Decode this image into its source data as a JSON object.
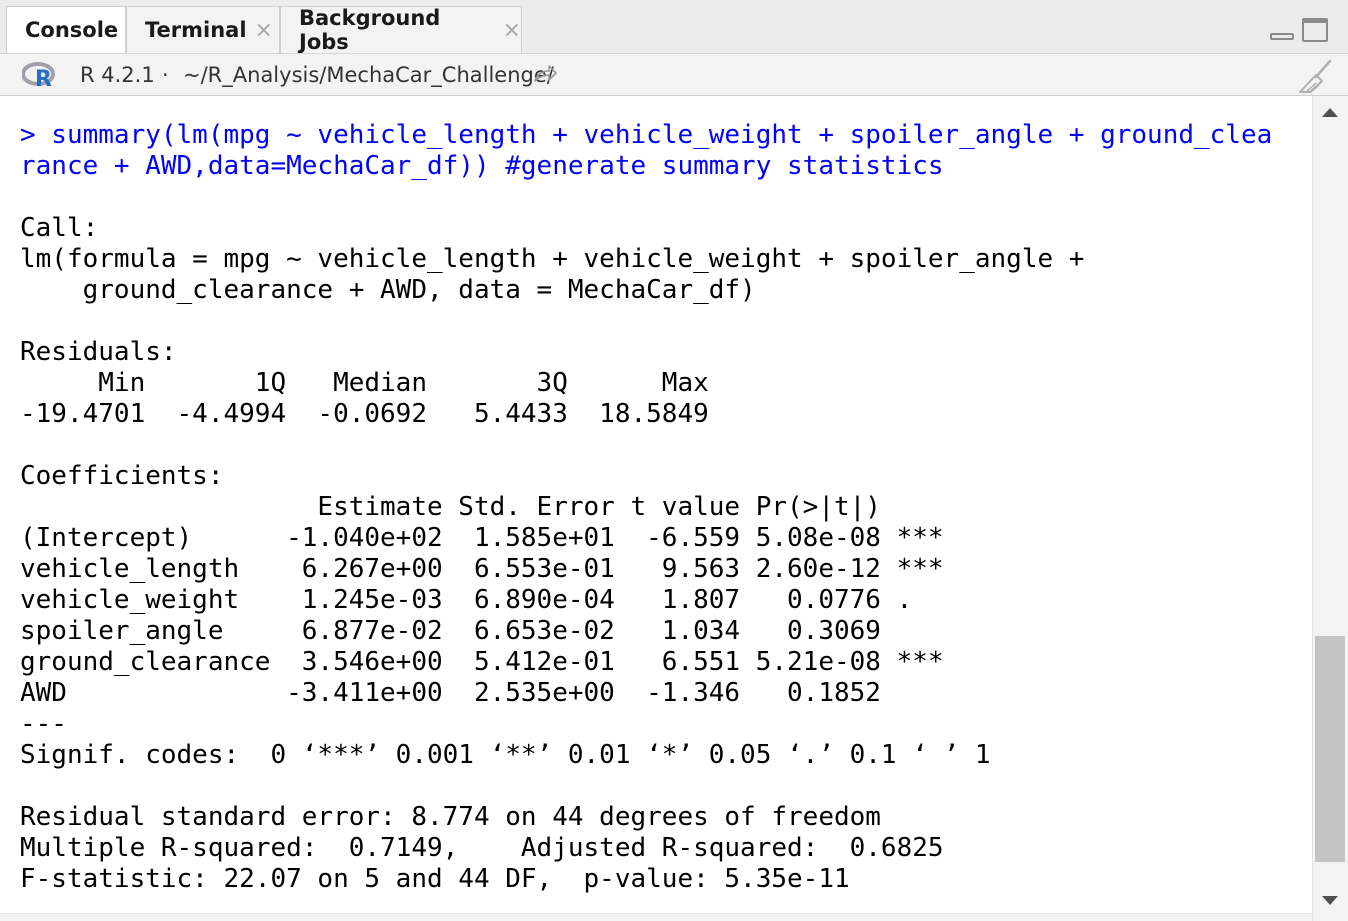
{
  "tabs": [
    {
      "label": "Console",
      "active": true
    },
    {
      "label": "Terminal",
      "close": "×"
    },
    {
      "label": "Background Jobs",
      "close": "×"
    }
  ],
  "pathbar": {
    "r_icon": "r-logo-icon",
    "r_version": "R 4.2.1",
    "separator": "·",
    "path": "~/R_Analysis/MechaCar_Challenge/"
  },
  "console": {
    "command": "> summary(lm(mpg ~ vehicle_length + vehicle_weight + spoiler_angle + ground_clea\nrance + AWD,data=MechaCar_df)) #generate summary statistics",
    "output": "\n\nCall:\nlm(formula = mpg ~ vehicle_length + vehicle_weight + spoiler_angle + \n    ground_clearance + AWD, data = MechaCar_df)\n\nResiduals:\n     Min       1Q   Median       3Q      Max \n-19.4701  -4.4994  -0.0692   5.4433  18.5849 \n\nCoefficients:\n                   Estimate Std. Error t value Pr(>|t|)    \n(Intercept)      -1.040e+02  1.585e+01  -6.559 5.08e-08 ***\nvehicle_length    6.267e+00  6.553e-01   9.563 2.60e-12 ***\nvehicle_weight    1.245e-03  6.890e-04   1.807   0.0776 .  \nspoiler_angle     6.877e-02  6.653e-02   1.034   0.3069    \nground_clearance  3.546e+00  5.412e-01   6.551 5.21e-08 ***\nAWD              -3.411e+00  2.535e+00  -1.346   0.1852    \n---\nSignif. codes:  0 ‘***’ 0.001 ‘**’ 0.01 ‘*’ 0.05 ‘.’ 0.1 ‘ ’ 1\n\nResidual standard error: 8.774 on 44 degrees of freedom\nMultiple R-squared:  0.7149,\tAdjusted R-squared:  0.6825 \nF-statistic: 22.07 on 5 and 44 DF,  p-value: 5.35e-11"
  },
  "colors": {
    "command_text": "#0000ff",
    "output_text": "#000000",
    "r_logo_blue": "#276dc3",
    "r_logo_gray": "#a0a0a8"
  },
  "icons": {
    "goto_directory": "arrow-right-icon",
    "clear_console": "broom-icon",
    "minimize": "minimize-icon",
    "maximize": "maximize-icon"
  }
}
